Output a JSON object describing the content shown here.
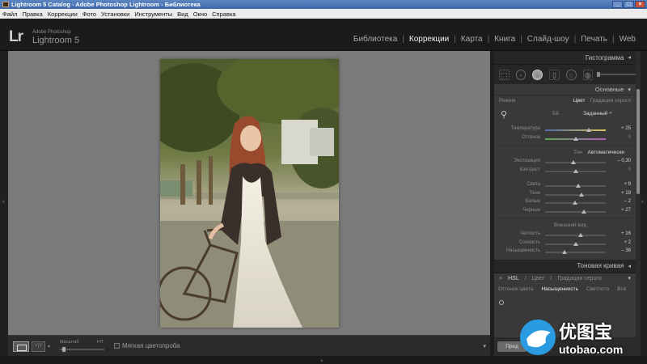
{
  "window": {
    "title": "Lightroom 5 Catalog - Adobe Photoshop Lightroom - Библиотека",
    "minimize": "_",
    "maximize": "□",
    "close": "×"
  },
  "menu": [
    "Файл",
    "Правка",
    "Коррекции",
    "Фото",
    "Установки",
    "Инструменты",
    "Вид",
    "Окно",
    "Справка"
  ],
  "identity": {
    "logo": "Lr",
    "product_small": "Adobe Photoshop",
    "product_big": "Lightroom 5"
  },
  "modules": [
    {
      "label": "Библиотека",
      "active": false
    },
    {
      "label": "Коррекции",
      "active": true
    },
    {
      "label": "Карта",
      "active": false
    },
    {
      "label": "Книга",
      "active": false
    },
    {
      "label": "Слайд-шоу",
      "active": false
    },
    {
      "label": "Печать",
      "active": false
    },
    {
      "label": "Web",
      "active": false
    }
  ],
  "toolbar": {
    "view_badge": "Y|Y",
    "zoom_label": "Масштаб",
    "zoom_fit": "FIT",
    "zoom_level": 0.05,
    "soft_proof": "Мягкая цветопроба",
    "menu_arrow": "▾"
  },
  "panel": {
    "histogram": "Гистограмма",
    "basic": "Основные",
    "treatment_label": "Режим",
    "treatment_color": "Цвет",
    "treatment_bw": "Градации серого",
    "wb_label": "ББ",
    "wb_value": "Заданный ÷",
    "tone_label": "Тон",
    "auto": "Автоматически",
    "presence": "Внешний вид",
    "tone_curve": "Тоновая кривая",
    "hsl": "HSL",
    "hsl_color": "Цвет",
    "hsl_gray": "Градации серого",
    "tabs": [
      "Оттенок цвета",
      "Насыщенность",
      "Светлота",
      "Всё"
    ],
    "prev_button": "Пред"
  },
  "sliders_wb": [
    {
      "label": "Температура",
      "value": "+ 25",
      "pos": 0.72,
      "track": "temp"
    },
    {
      "label": "Оттенок",
      "value": "0",
      "pos": 0.5,
      "track": "tint"
    }
  ],
  "sliders_tone": [
    {
      "label": "Экспозиция",
      "value": "– 0,30",
      "pos": 0.47
    },
    {
      "label": "Контраст",
      "value": "0",
      "pos": 0.5
    }
  ],
  "sliders_tone2": [
    {
      "label": "Света",
      "value": "+ 9",
      "pos": 0.55
    },
    {
      "label": "Тени",
      "value": "+ 19",
      "pos": 0.6
    },
    {
      "label": "Белые",
      "value": "– 2",
      "pos": 0.49
    },
    {
      "label": "Черные",
      "value": "+ 27",
      "pos": 0.64
    }
  ],
  "sliders_presence": [
    {
      "label": "Четкость",
      "value": "+ 16",
      "pos": 0.58
    },
    {
      "label": "Сочность",
      "value": "+ 2",
      "pos": 0.51
    },
    {
      "label": "Насыщенность",
      "value": "– 36",
      "pos": 0.32
    }
  ],
  "watermark": {
    "big": "优图宝",
    "small": "utobao.com"
  }
}
